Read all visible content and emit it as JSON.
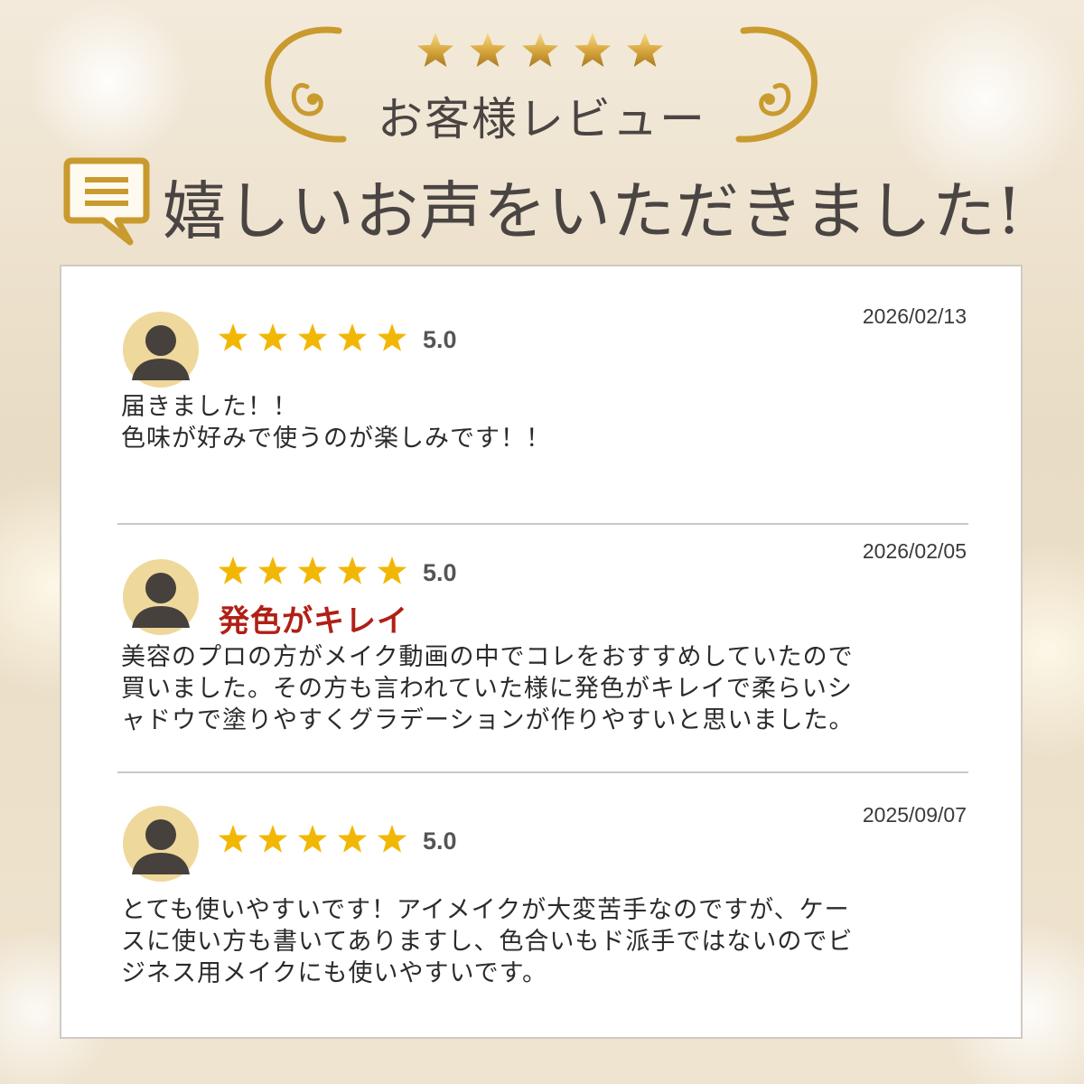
{
  "header": {
    "stars_count": 5,
    "subtitle": "お客様レビュー",
    "title": "嬉しいお声をいただきました!"
  },
  "colors": {
    "gold": "#c99a2e",
    "star": "#f2b705",
    "headline_red": "#b02015",
    "avatar_bg": "#efd89b",
    "avatar_fg": "#46413d"
  },
  "reviews": [
    {
      "rating": 5,
      "rating_text": "5.0",
      "date": "2026/02/13",
      "headline": "",
      "body": "届きました！！\n色味が好みで使うのが楽しみです！！"
    },
    {
      "rating": 5,
      "rating_text": "5.0",
      "date": "2026/02/05",
      "headline": "発色がキレイ",
      "body": "美容のプロの方がメイク動画の中でコレをおすすめしていたので\n買いました。その方も言われていた様に発色がキレイで柔らいシ\nャドウで塗りやすくグラデーションが作りやすいと思いました。"
    },
    {
      "rating": 5,
      "rating_text": "5.0",
      "date": "2025/09/07",
      "headline": "",
      "body": "とても使いやすいです！アイメイクが大変苦手なのですが、ケー\nスに使い方も書いてありますし、色合いもド派手ではないのでビ\nジネス用メイクにも使いやすいです。"
    }
  ]
}
